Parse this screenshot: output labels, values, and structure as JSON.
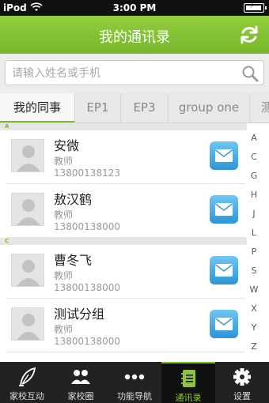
{
  "status_bar": {
    "carrier": "iPod",
    "time": "3:00 PM",
    "battery_level": 0.9
  },
  "header": {
    "title": "我的通讯录",
    "refresh_icon": "refresh-icon"
  },
  "search": {
    "placeholder": "请输入姓名或手机",
    "value": ""
  },
  "tabs": [
    {
      "label": "我的同事",
      "active": true
    },
    {
      "label": "EP1",
      "active": false
    },
    {
      "label": "EP3",
      "active": false
    },
    {
      "label": "group one",
      "active": false
    },
    {
      "label": "测",
      "active": false
    }
  ],
  "sections": [
    {
      "letter": "A",
      "contacts": [
        {
          "name": "安微",
          "role": "教师",
          "phone": "13800138123"
        },
        {
          "name": "敖汉鹤",
          "role": "教师",
          "phone": "13800138000"
        }
      ]
    },
    {
      "letter": "C",
      "contacts": [
        {
          "name": "曹冬飞",
          "role": "教师",
          "phone": "13800138000"
        },
        {
          "name": "测试分组",
          "role": "教师",
          "phone": "13800138000"
        }
      ]
    }
  ],
  "index_letters": [
    "A",
    "C",
    "G",
    "H",
    "J",
    "L",
    "P",
    "S",
    "W",
    "X",
    "Y",
    "Z"
  ],
  "tabbar": [
    {
      "label": "家校互动",
      "icon": "feather-icon",
      "active": false
    },
    {
      "label": "家校圈",
      "icon": "people-icon",
      "active": false
    },
    {
      "label": "功能导航",
      "icon": "more-dots-icon",
      "active": false
    },
    {
      "label": "通讯录",
      "icon": "contact-book-icon",
      "active": true
    },
    {
      "label": "设置",
      "icon": "gear-icon",
      "active": false
    }
  ],
  "colors": {
    "accent": "#7ab82c",
    "mail_button": "#2c96d8"
  }
}
